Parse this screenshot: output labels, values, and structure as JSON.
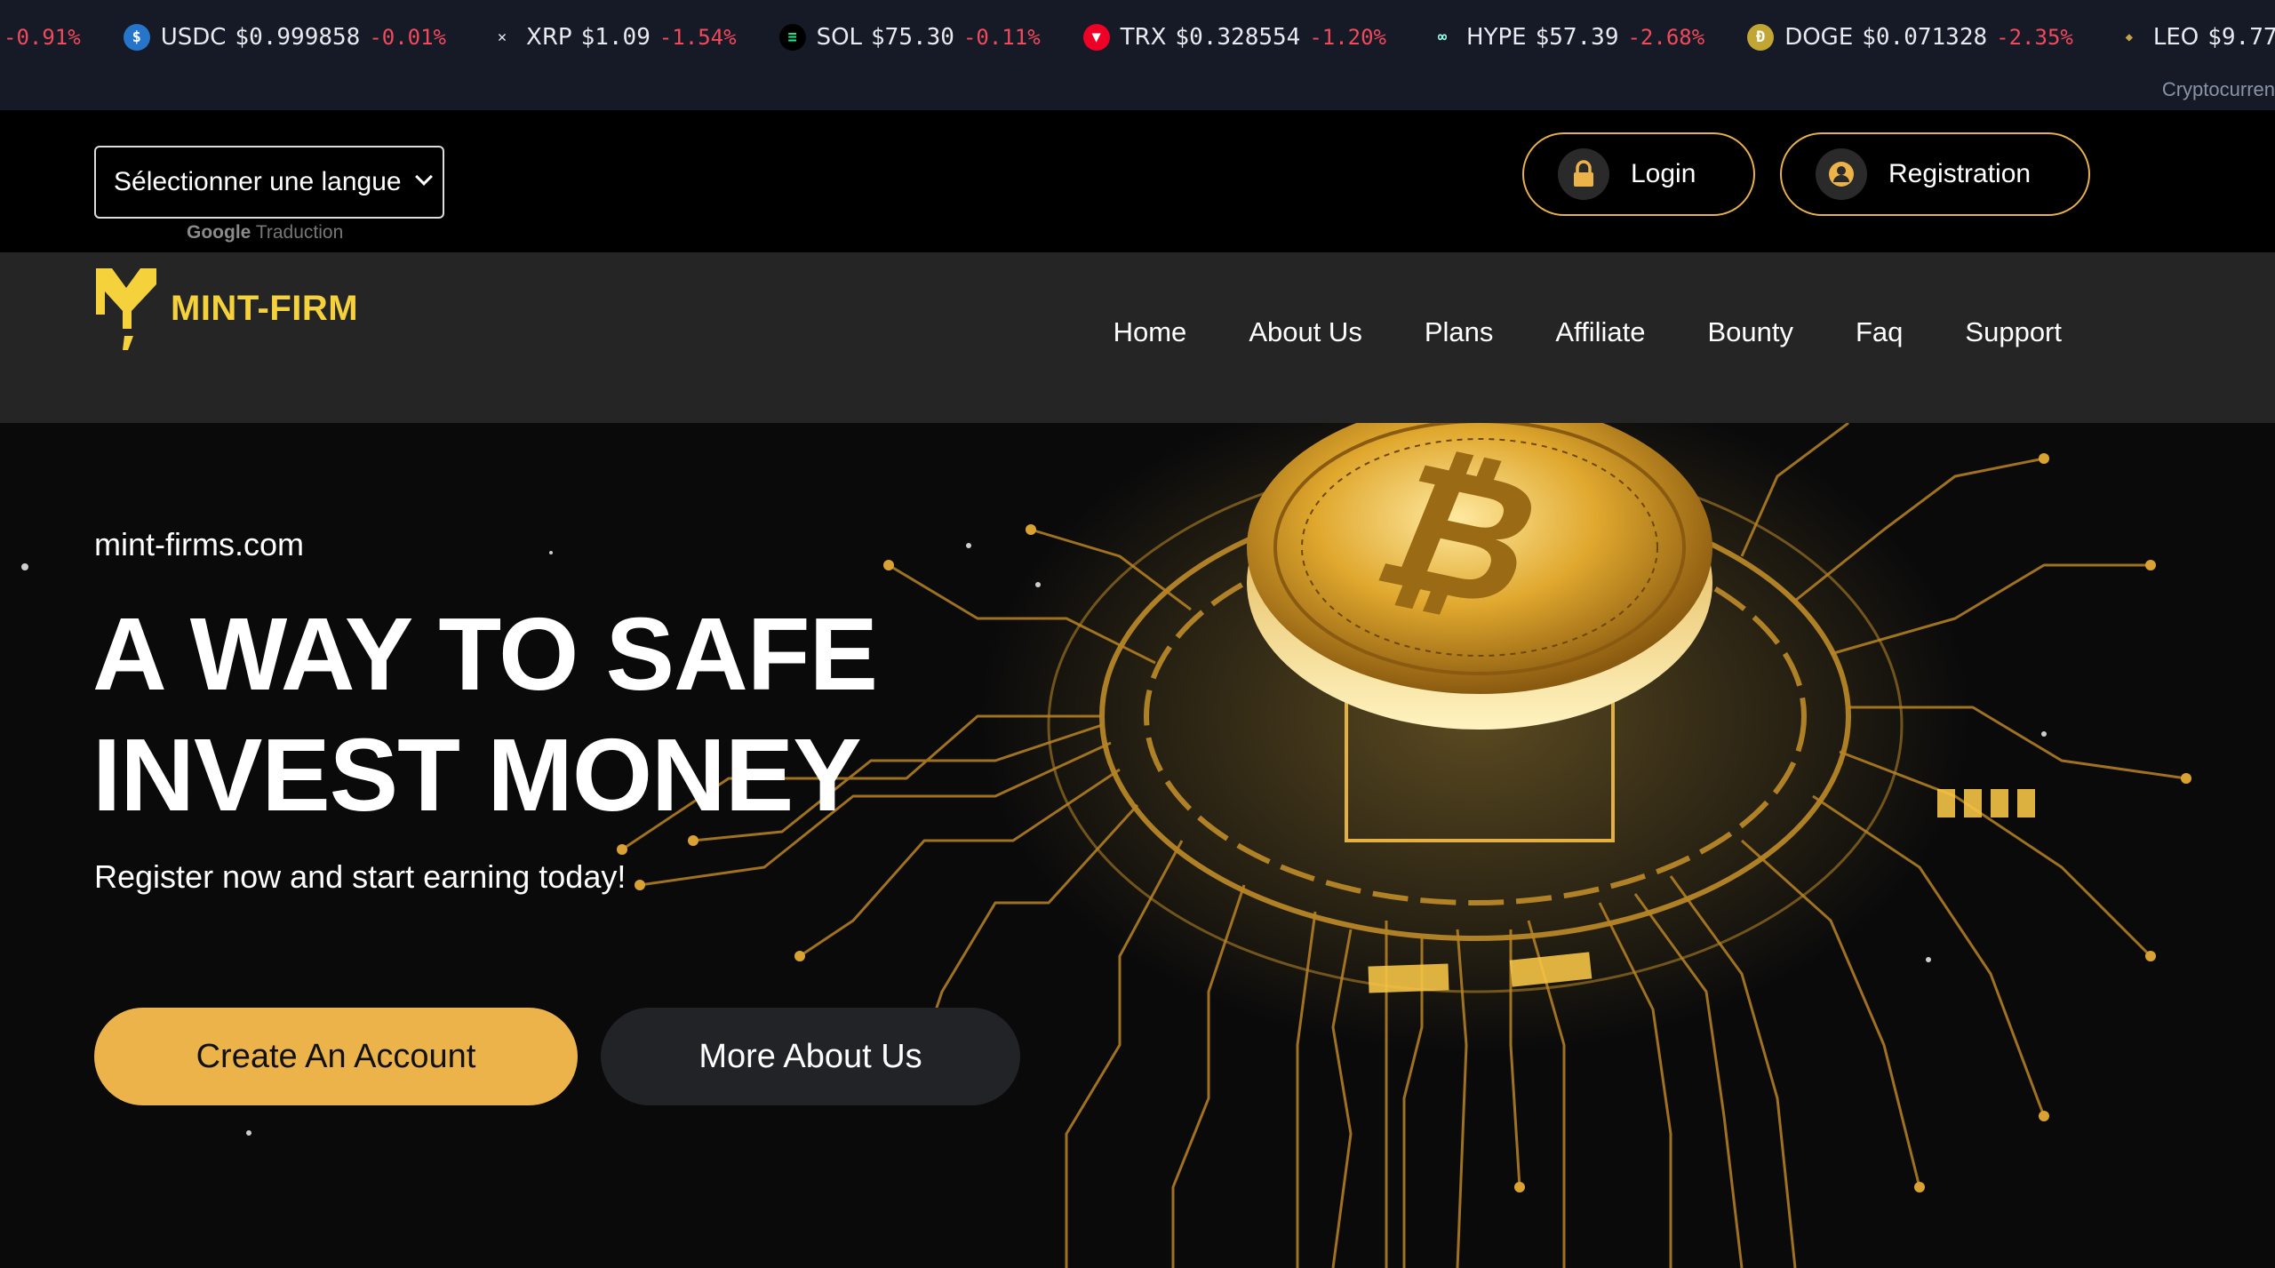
{
  "ticker": {
    "items": [
      {
        "symbol": "",
        "price": "",
        "change": "-0.91%",
        "icon": "partial-coin-icon",
        "color": "#f2495c"
      },
      {
        "symbol": "USDC",
        "price": "$0.999858",
        "change": "-0.01%",
        "icon": "usdc-icon",
        "color": "#2775ca"
      },
      {
        "symbol": "XRP",
        "price": "$1.09",
        "change": "-1.54%",
        "icon": "xrp-icon",
        "color": "#ffffff"
      },
      {
        "symbol": "SOL",
        "price": "$75.30",
        "change": "-0.11%",
        "icon": "sol-icon",
        "color": "#14f195"
      },
      {
        "symbol": "TRX",
        "price": "$0.328554",
        "change": "-1.20%",
        "icon": "trx-icon",
        "color": "#ef0027"
      },
      {
        "symbol": "HYPE",
        "price": "$57.39",
        "change": "-2.68%",
        "icon": "hype-icon",
        "color": "#97fce4"
      },
      {
        "symbol": "DOGE",
        "price": "$0.071328",
        "change": "-2.35%",
        "icon": "doge-icon",
        "color": "#c2a633"
      },
      {
        "symbol": "LEO",
        "price": "$9.77",
        "change": "+",
        "icon": "leo-icon",
        "color": "#c4a44a"
      }
    ],
    "caption": "Cryptocurren"
  },
  "language": {
    "select_label": "Sélectionner une langue",
    "credit_google": "Google",
    "credit_text": "Traduction"
  },
  "auth": {
    "login_label": "Login",
    "registration_label": "Registration"
  },
  "brand": {
    "name": "MINT-FIRM",
    "color": "#f5d23c"
  },
  "nav": {
    "items": [
      "Home",
      "About Us",
      "Plans",
      "Affiliate",
      "Bounty",
      "Faq",
      "Support"
    ]
  },
  "hero": {
    "domain": "mint-firms.com",
    "headline_line1": "A WAY TO SAFE",
    "headline_line2": "INVEST MONEY",
    "subtitle": "Register now and start earning today!",
    "cta_primary": "Create An Account",
    "cta_secondary": "More About Us",
    "accent": "#ecb34b"
  }
}
